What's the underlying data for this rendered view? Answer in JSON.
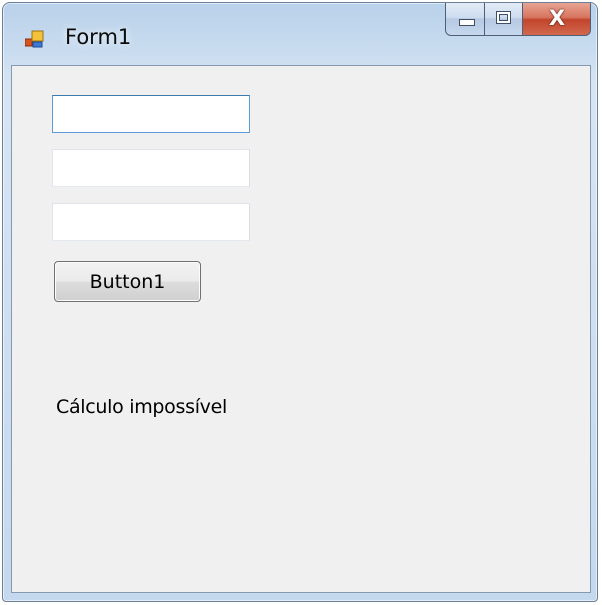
{
  "window": {
    "title": "Form1",
    "icon": "winforms-app-icon"
  },
  "caption_buttons": {
    "minimize_icon": "minimize-icon",
    "maximize_icon": "maximize-icon",
    "close_icon": "close-icon",
    "close_glyph": "X"
  },
  "form": {
    "textbox1_value": "",
    "textbox2_value": "",
    "textbox3_value": "",
    "button1_label": "Button1",
    "label1_text": "Cálculo impossível"
  },
  "colors": {
    "client_background": "#f0f0f0",
    "close_button": "#c2452c",
    "focus_border": "#5d9ad7"
  }
}
